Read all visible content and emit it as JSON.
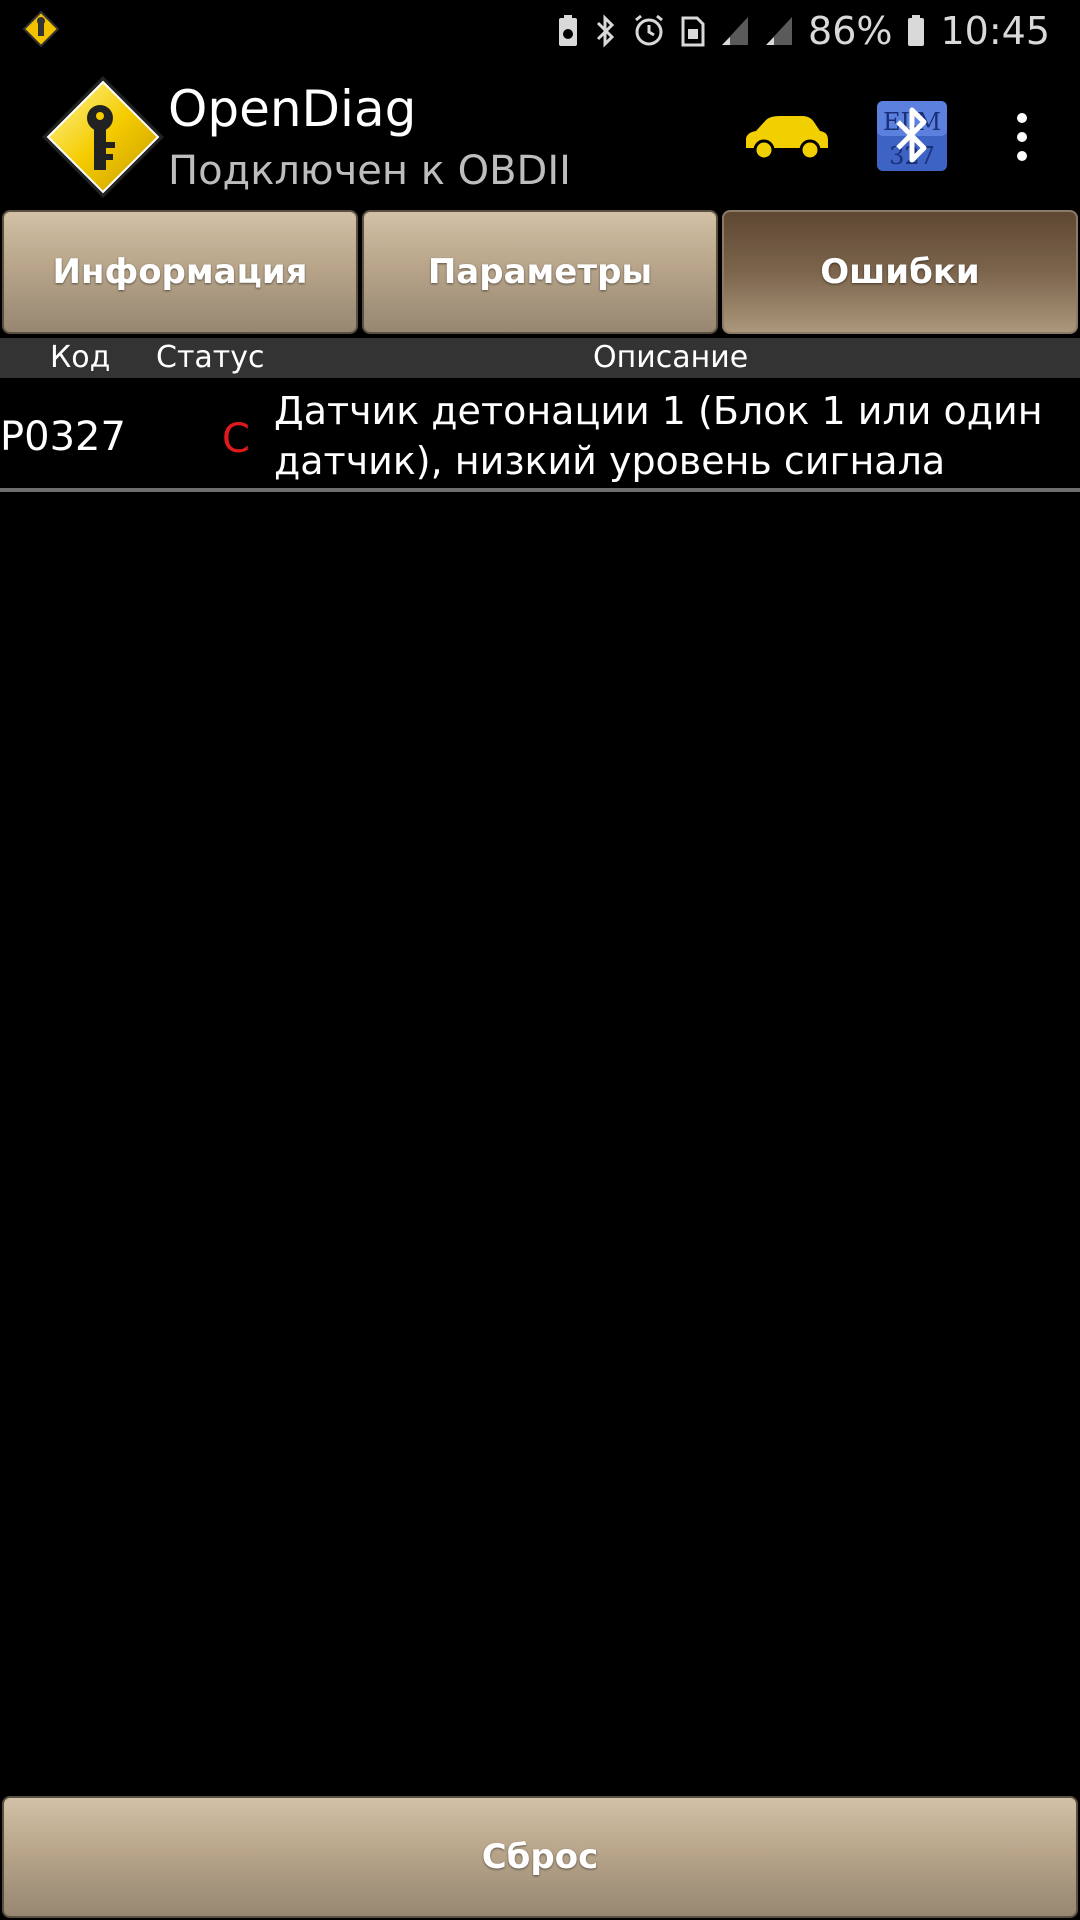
{
  "status_bar": {
    "battery_percent": "86%",
    "time": "10:45",
    "icons": [
      "opendiag-notification-icon",
      "battery-saver-icon",
      "bluetooth-icon",
      "alarm-icon",
      "sim-icon",
      "signal-icon",
      "signal-icon-2",
      "battery-icon"
    ]
  },
  "app_bar": {
    "title": "OpenDiag",
    "subtitle": "Подключен к OBDII",
    "logo_icon": "opendiag-logo-icon",
    "car_icon": "car-icon",
    "adapter_icon": "elm327-bluetooth-icon",
    "menu_icon": "overflow-menu-icon",
    "car_color": "#f2cf00"
  },
  "tabs": [
    {
      "label": "Информация",
      "active": false
    },
    {
      "label": "Параметры",
      "active": false
    },
    {
      "label": "Ошибки",
      "active": true
    }
  ],
  "table": {
    "headers": {
      "code": "Код",
      "status": "Статус",
      "description": "Описание"
    },
    "rows": [
      {
        "code": "P0327",
        "status": "C",
        "description": "Датчик детонации 1 (Блок 1 или один датчик), низкий уровень сигнала"
      }
    ],
    "status_color": "#e0191c"
  },
  "footer": {
    "reset_label": "Сброс"
  }
}
